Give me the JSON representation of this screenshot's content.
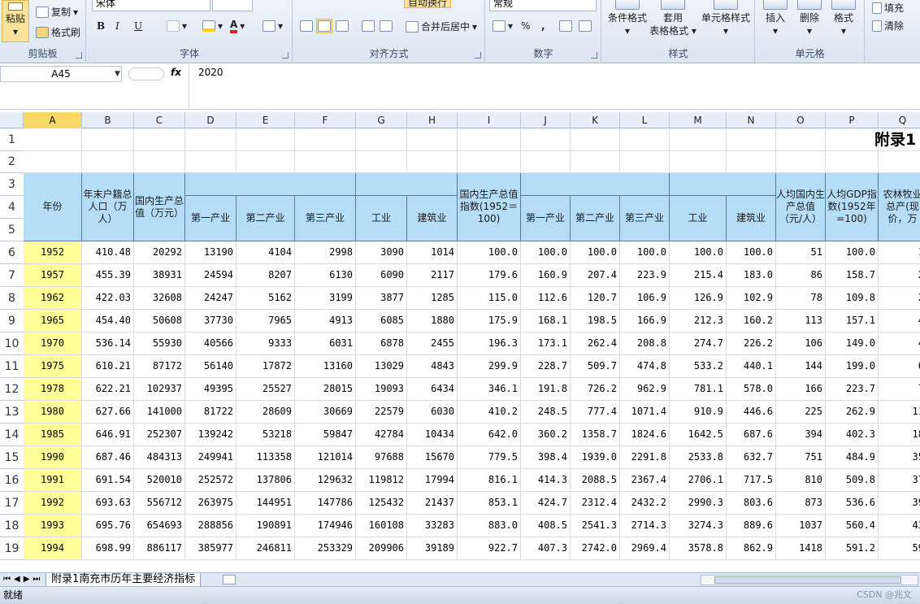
{
  "ribbon": {
    "clipboard": {
      "paste": "粘贴",
      "copy": "复制",
      "format_painter": "格式刷",
      "group": "剪贴板"
    },
    "font": {
      "name": "宋体",
      "group": "字体",
      "bold": "B",
      "italic": "I",
      "underline": "U",
      "color_letter": "A"
    },
    "alignment": {
      "wrap": "自动换行",
      "merge": "合并后居中",
      "group": "对齐方式"
    },
    "number": {
      "format": "常规",
      "percent": "%",
      "comma": ",",
      "group": "数字"
    },
    "styles": {
      "cond": "条件格式",
      "table": "套用\n表格格式",
      "cell": "单元格样式",
      "group": "样式"
    },
    "cells": {
      "insert": "插入",
      "delete": "删除",
      "format": "格式",
      "group": "单元格"
    },
    "editing": {
      "fill": "填充",
      "clear": "清除"
    }
  },
  "formula_bar": {
    "name_box": "A45",
    "fx": "fx",
    "content": "2020"
  },
  "columns": [
    "A",
    "B",
    "C",
    "D",
    "E",
    "F",
    "G",
    "H",
    "I",
    "J",
    "K",
    "L",
    "M",
    "N",
    "O",
    "P",
    "Q"
  ],
  "selected_column": "A",
  "rows": [
    "1",
    "2",
    "3",
    "4",
    "5",
    "6",
    "7",
    "8",
    "9",
    "10",
    "11",
    "12",
    "13",
    "14",
    "15",
    "16",
    "17",
    "18",
    "19"
  ],
  "title_partial": "附录1",
  "headers": {
    "year": "年份",
    "pop": "年末户籍总人口（万人）",
    "gdp": "国内生产总值（万元）",
    "primary": "第一产业",
    "secondary": "第二产业",
    "tertiary": "第三产业",
    "industry": "工业",
    "construction": "建筑业",
    "gdp_index": "国内生产总值指数(1952＝100)",
    "primary2": "第一产业",
    "secondary2": "第二产业",
    "tertiary2": "第三产业",
    "industry2": "工业",
    "construction2": "建筑业",
    "per_capita": "人均国内生产总值（元/人）",
    "per_capita_index": "人均GDP指数(1952年=100)",
    "agri_partial": "农林牧业总产(现价，万"
  },
  "data": [
    [
      "1952",
      "410.48",
      "20292",
      "13190",
      "4104",
      "2998",
      "3090",
      "1014",
      "100.0",
      "100.0",
      "100.0",
      "100.0",
      "100.0",
      "100.0",
      "51",
      "100.0",
      "1"
    ],
    [
      "1957",
      "455.39",
      "38931",
      "24594",
      "8207",
      "6130",
      "6090",
      "2117",
      "179.6",
      "160.9",
      "207.4",
      "223.9",
      "215.4",
      "183.0",
      "86",
      "158.7",
      "2"
    ],
    [
      "1962",
      "422.03",
      "32608",
      "24247",
      "5162",
      "3199",
      "3877",
      "1285",
      "115.0",
      "112.6",
      "120.7",
      "106.9",
      "126.9",
      "102.9",
      "78",
      "109.8",
      "2"
    ],
    [
      "1965",
      "454.40",
      "50608",
      "37730",
      "7965",
      "4913",
      "6085",
      "1880",
      "175.9",
      "168.1",
      "198.5",
      "166.9",
      "212.3",
      "160.2",
      "113",
      "157.1",
      "4"
    ],
    [
      "1970",
      "536.14",
      "55930",
      "40566",
      "9333",
      "6031",
      "6878",
      "2455",
      "196.3",
      "173.1",
      "262.4",
      "208.8",
      "274.7",
      "226.2",
      "106",
      "149.0",
      "4"
    ],
    [
      "1975",
      "610.21",
      "87172",
      "56140",
      "17872",
      "13160",
      "13029",
      "4843",
      "299.9",
      "228.7",
      "509.7",
      "474.8",
      "533.2",
      "440.1",
      "144",
      "199.0",
      "6"
    ],
    [
      "1978",
      "622.21",
      "102937",
      "49395",
      "25527",
      "28015",
      "19093",
      "6434",
      "346.1",
      "191.8",
      "726.2",
      "962.9",
      "781.1",
      "578.0",
      "166",
      "223.7",
      "7"
    ],
    [
      "1980",
      "627.66",
      "141000",
      "81722",
      "28609",
      "30669",
      "22579",
      "6030",
      "410.2",
      "248.5",
      "777.4",
      "1071.4",
      "910.9",
      "446.6",
      "225",
      "262.9",
      "11"
    ],
    [
      "1985",
      "646.91",
      "252307",
      "139242",
      "53218",
      "59847",
      "42784",
      "10434",
      "642.0",
      "360.2",
      "1358.7",
      "1824.6",
      "1642.5",
      "687.6",
      "394",
      "402.3",
      "18"
    ],
    [
      "1990",
      "687.46",
      "484313",
      "249941",
      "113358",
      "121014",
      "97688",
      "15670",
      "779.5",
      "398.4",
      "1939.0",
      "2291.8",
      "2533.8",
      "632.7",
      "751",
      "484.9",
      "35"
    ],
    [
      "1991",
      "691.54",
      "520010",
      "252572",
      "137806",
      "129632",
      "119812",
      "17994",
      "816.1",
      "414.3",
      "2088.5",
      "2367.4",
      "2706.1",
      "717.5",
      "810",
      "509.8",
      "37"
    ],
    [
      "1992",
      "693.63",
      "556712",
      "263975",
      "144951",
      "147786",
      "125432",
      "21437",
      "853.1",
      "424.7",
      "2312.4",
      "2432.2",
      "2990.3",
      "803.6",
      "873",
      "536.6",
      "39"
    ],
    [
      "1993",
      "695.76",
      "654693",
      "288856",
      "190891",
      "174946",
      "160108",
      "33283",
      "883.0",
      "408.5",
      "2541.3",
      "2714.3",
      "3274.3",
      "889.6",
      "1037",
      "560.4",
      "43"
    ],
    [
      "1994",
      "698.99",
      "886117",
      "385977",
      "246811",
      "253329",
      "209906",
      "39189",
      "922.7",
      "407.3",
      "2742.0",
      "2969.4",
      "3578.8",
      "862.9",
      "1418",
      "591.2",
      "59"
    ]
  ],
  "sheet_tab": "附录1南充市历年主要经济指标",
  "status": {
    "ready": "就绪",
    "watermark": "CSDN @兆文"
  }
}
